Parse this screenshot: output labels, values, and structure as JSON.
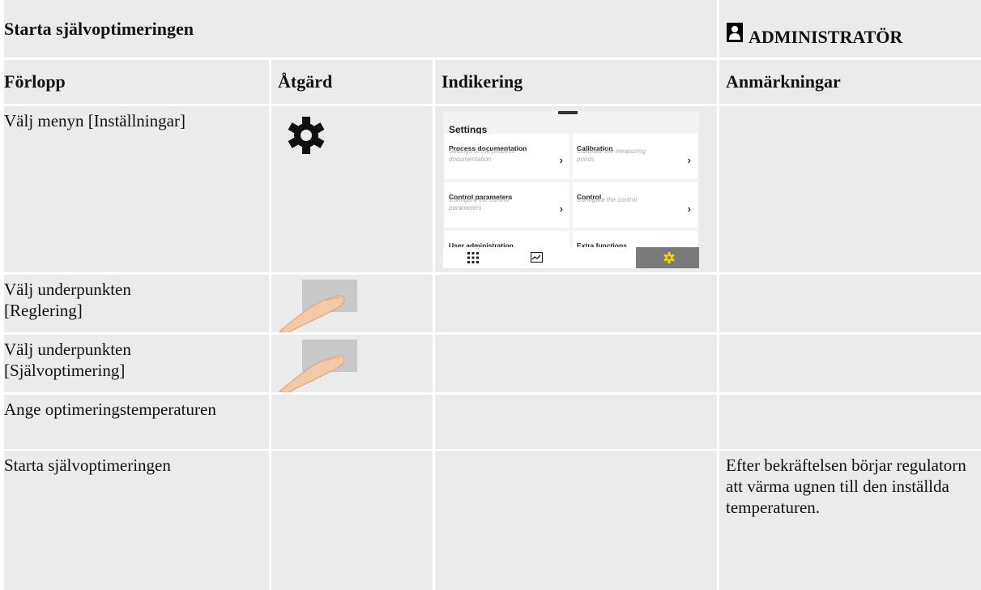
{
  "header": {
    "title": "Starta självoptimeringen",
    "role": "ADMINISTRATÖR"
  },
  "columns": [
    "Förlopp",
    "Åtgärd",
    "Indikering",
    "Anmärkningar"
  ],
  "rows": [
    {
      "step": "Välj menyn [Inställningar]",
      "action_icon": "gear-icon",
      "note": ""
    },
    {
      "step": "Välj underpunkten [Reglering]",
      "action_icon": "finger-tap-icon",
      "note": ""
    },
    {
      "step": "Välj underpunkten [Självoptimering]",
      "action_icon": "finger-tap-icon",
      "note": ""
    },
    {
      "step": "Ange optimeringstemperaturen",
      "action_icon": "",
      "note": ""
    },
    {
      "step": "Starta självoptimeringen",
      "action_icon": "",
      "note": "Efter bekräftelsen börjar regulatorn att värma ugnen till den inställda temperaturen."
    }
  ],
  "screen": {
    "title": "Settings",
    "tiles": [
      {
        "title": "Process documentation",
        "subtitle": "Settings of the process documentation"
      },
      {
        "title": "Calibration",
        "subtitle": "Calibrate the measuring points"
      },
      {
        "title": "Control parameters",
        "subtitle": "Configure the control parameters"
      },
      {
        "title": "Control",
        "subtitle": "Configure the control"
      },
      {
        "title": "User administration",
        "subtitle": ""
      },
      {
        "title": "Extra functions",
        "subtitle": ""
      }
    ],
    "nav_icons": [
      "apps-grid-icon",
      "chart-icon",
      "settings-icon"
    ],
    "accent_color": "#f2d600"
  },
  "colors": {
    "cell_bg": "#ebebeb",
    "separator": "#ffffff"
  }
}
